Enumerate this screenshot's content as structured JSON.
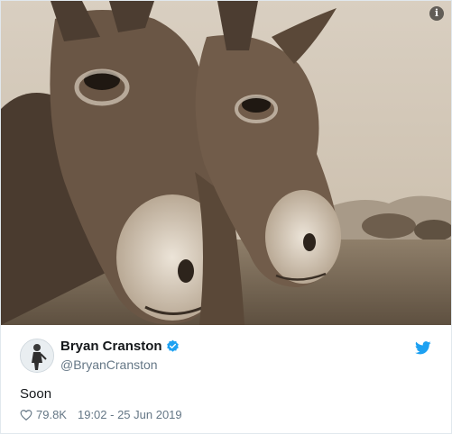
{
  "media": {
    "image_icon": "donkeys-photo",
    "info_icon": "info-icon",
    "info_glyph": "i"
  },
  "tweet": {
    "display_name": "Bryan Cranston",
    "handle": "@BryanCranston",
    "verified_icon": "verified-badge-icon",
    "brand_icon": "twitter-bird-icon",
    "text": "Soon",
    "likes": "79.8K",
    "like_icon": "heart-icon",
    "timestamp": "19:02 - 25 Jun 2019"
  },
  "colors": {
    "twitter_blue": "#1da1f2",
    "text": "#14171a",
    "muted": "#657786",
    "border": "#e1e8ed"
  }
}
